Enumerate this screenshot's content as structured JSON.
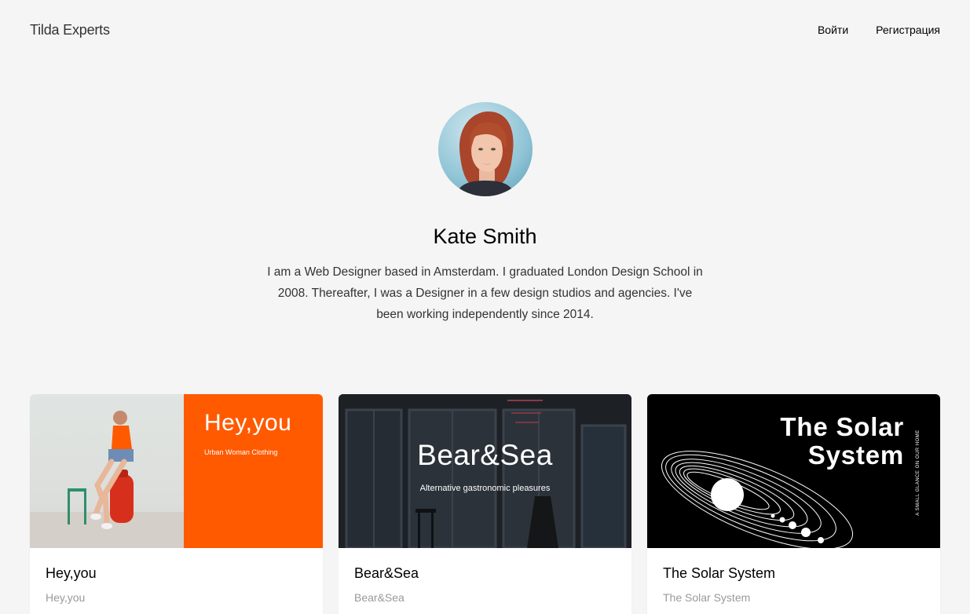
{
  "header": {
    "logo": "Tilda Experts",
    "nav": {
      "login": "Войти",
      "register": "Регистрация"
    }
  },
  "profile": {
    "name": "Kate Smith",
    "bio": "I am a Web Designer based in Amsterdam. I graduated London Design School in 2008. Thereafter, I was a Designer in a few design studios and agencies. I've been working independently since 2014."
  },
  "cards": [
    {
      "cover_title": "Hey,you",
      "cover_subtitle": "Urban Woman Clothing",
      "title": "Hey,you",
      "subtitle": "Hey,you",
      "accent": "#ff5a00"
    },
    {
      "cover_title": "Bear&Sea",
      "cover_subtitle": "Alternative gastronomic pleasures",
      "title": "Bear&Sea",
      "subtitle": "Bear&Sea"
    },
    {
      "cover_title_line1": "The Solar",
      "cover_title_line2": "System",
      "cover_vertical": "A SMALL GLANCE ON OUR HOME",
      "title": "The Solar System",
      "subtitle": "The Solar System"
    }
  ]
}
